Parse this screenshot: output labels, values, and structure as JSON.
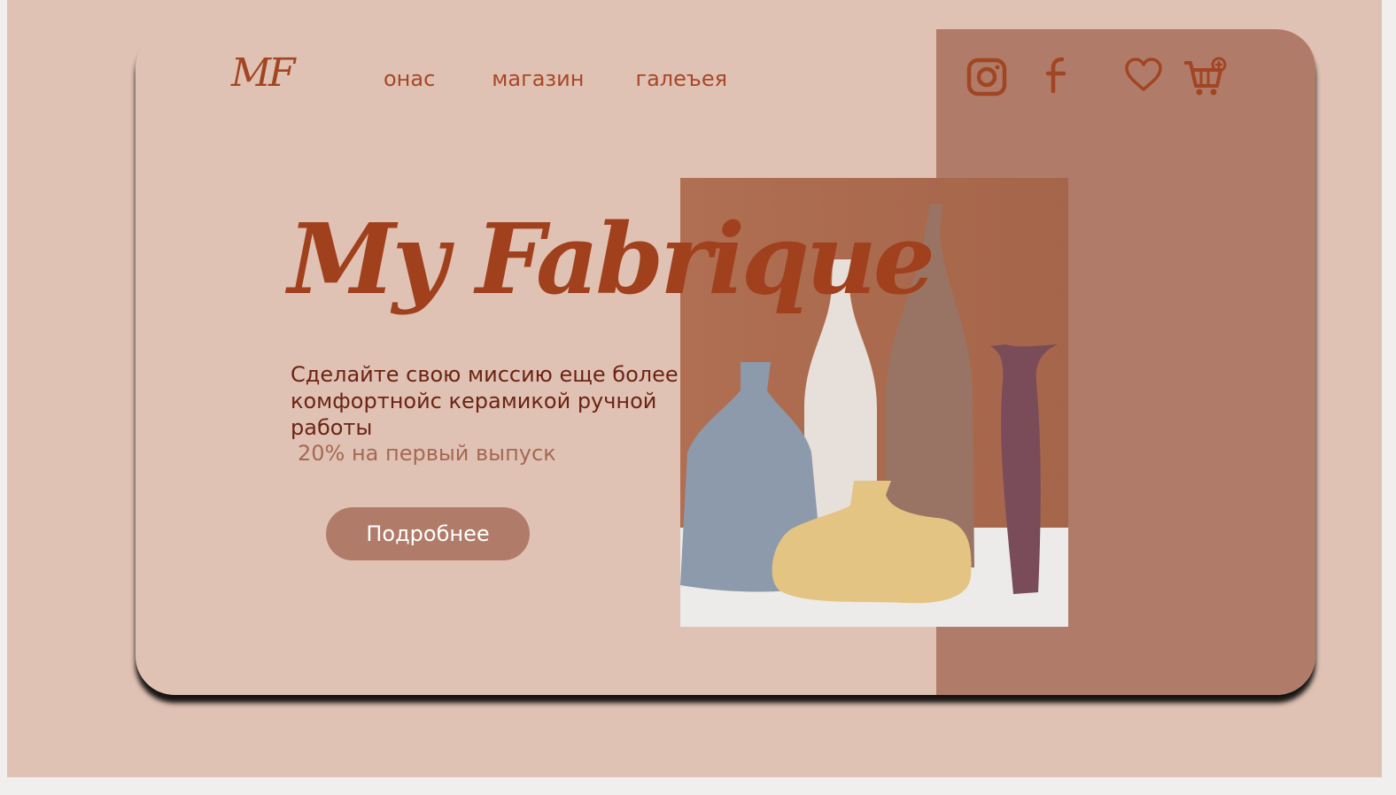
{
  "brand": {
    "logo_text": "MF",
    "title": "My Fabrique",
    "colors": {
      "background": "#e0c2b4",
      "panel": "#b07c69",
      "accent": "#a0401d"
    }
  },
  "nav": {
    "items": [
      {
        "label": "онас"
      },
      {
        "label": "магазин"
      },
      {
        "label": "галеъея"
      }
    ]
  },
  "header_icons": [
    "instagram-icon",
    "facebook-icon",
    "heart-icon",
    "cart-add-icon"
  ],
  "hero": {
    "text": "Сделайте свою миссию еще более комфортнойс керамикой ручной работы",
    "promo": "20% на первый выпуск",
    "cta_label": "Подробнее",
    "image": "ceramic-vases-photo"
  }
}
